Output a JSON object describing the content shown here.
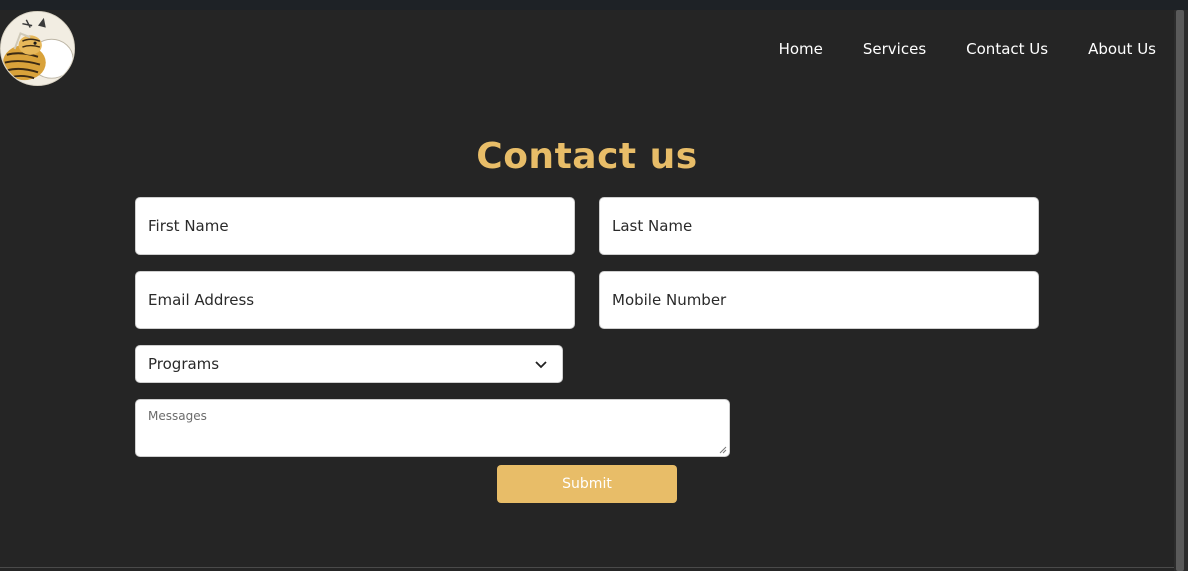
{
  "nav": {
    "items": [
      {
        "label": "Home"
      },
      {
        "label": "Services"
      },
      {
        "label": "Contact Us"
      },
      {
        "label": "About Us"
      }
    ]
  },
  "logo": {
    "icon": "tiger-logo"
  },
  "main": {
    "title": "Contact us",
    "form": {
      "first_name": {
        "value": "",
        "placeholder": "First Name"
      },
      "last_name": {
        "value": "",
        "placeholder": "Last Name"
      },
      "email": {
        "value": "",
        "placeholder": "Email Address"
      },
      "mobile": {
        "value": "",
        "placeholder": "Mobile Number"
      },
      "programs": {
        "selected": "Programs"
      },
      "messages": {
        "value": "",
        "placeholder": "Messages"
      },
      "submit_label": "Submit"
    }
  },
  "colors": {
    "background": "#252525",
    "accent": "#e8bd68",
    "field": "#ffffff"
  }
}
